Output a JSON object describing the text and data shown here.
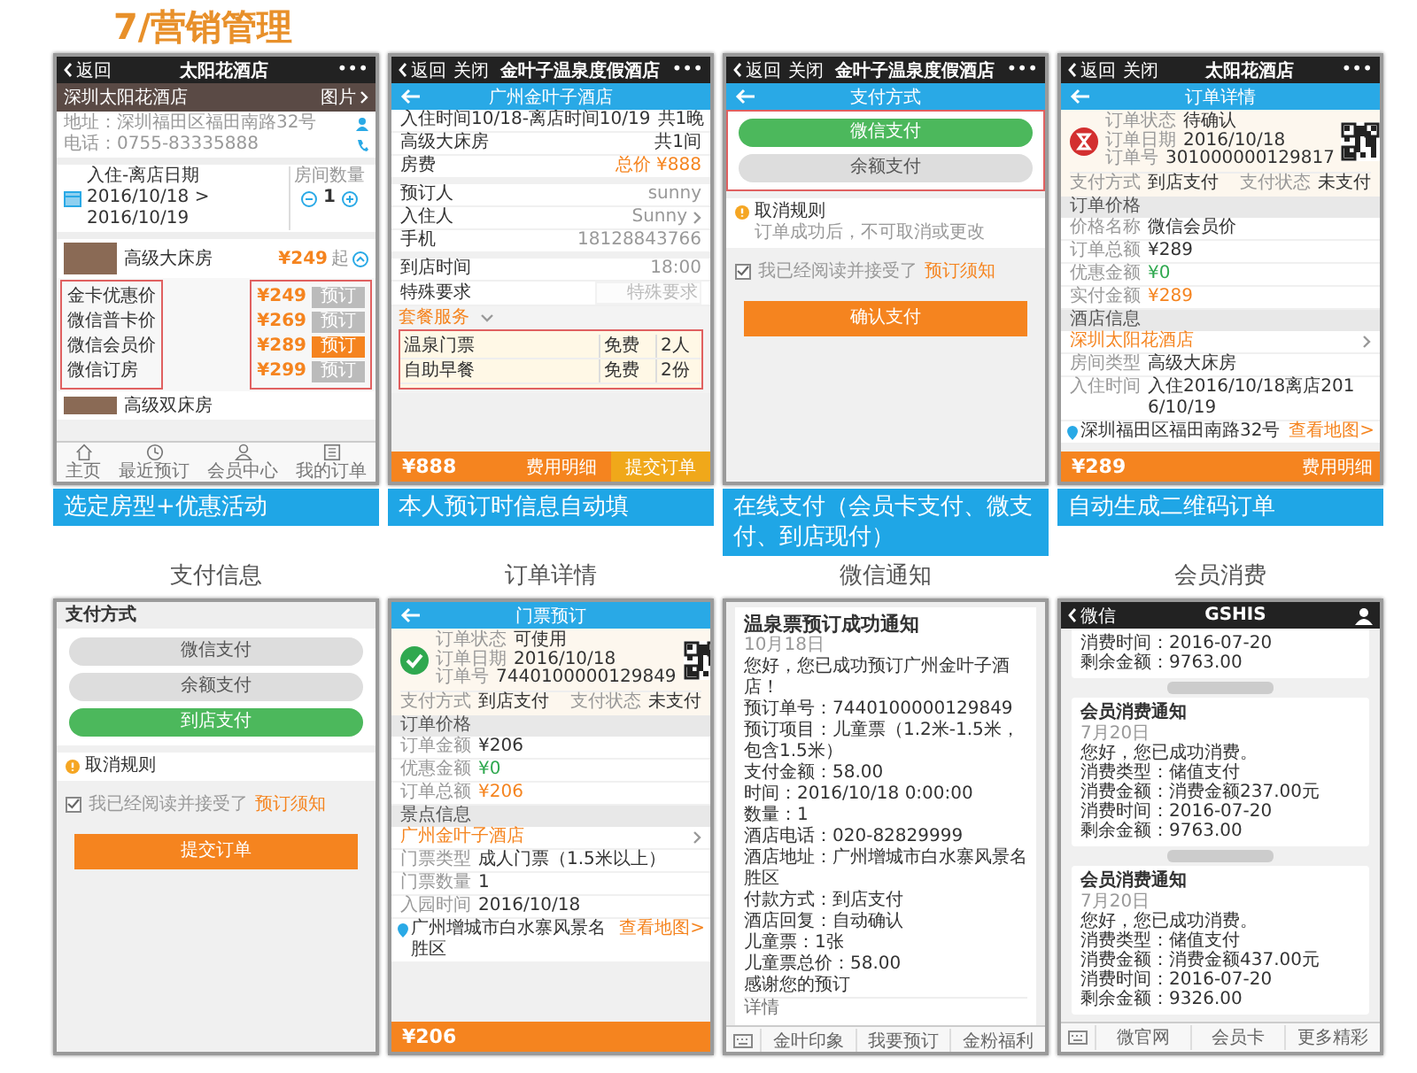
{
  "title": "7/营销管理",
  "top_row": [
    {
      "caption": "选定房型+优惠活动",
      "blocks": [
        {
          "kind": "navbar",
          "back": "返回",
          "title": "太阳花酒店",
          "more": "•••"
        },
        {
          "kind": "hotel",
          "name": "深圳太阳花酒店",
          "photos": "图片"
        },
        {
          "kind": "contact",
          "address": "地址：深圳福田区福田南路32号",
          "phone": "电话：0755-83335888"
        },
        {
          "kind": "dates",
          "label": "入住-离店日期",
          "range": "2016/10/18 > 2016/10/19",
          "count_label": "房间数量",
          "count": "1"
        },
        {
          "kind": "room",
          "name": "高级大床房",
          "price": "¥249",
          "unit": "起"
        },
        {
          "kind": "prices",
          "highlighted": true,
          "items": [
            {
              "label": "金卡优惠价",
              "price": "¥249",
              "button": "预订",
              "selected": false
            },
            {
              "label": "微信普卡价",
              "price": "¥269",
              "button": "预订",
              "selected": false
            },
            {
              "label": "微信会员价",
              "price": "¥289",
              "button": "预订",
              "selected": true
            },
            {
              "label": "微信订房",
              "price": "¥299",
              "button": "预订",
              "selected": false
            }
          ]
        },
        {
          "kind": "room_more",
          "name": "高级双床房"
        },
        {
          "kind": "tabbar",
          "items": [
            "主页",
            "最近预订",
            "会员中心",
            "我的订单"
          ]
        }
      ]
    },
    {
      "caption": "本人预订时信息自动填",
      "blocks": [
        {
          "kind": "navbar",
          "back": "返回",
          "close": "关闭",
          "title": "金叶子温泉度假酒店",
          "more": "•••"
        },
        {
          "kind": "bluebar",
          "title": "广州金叶子酒店"
        },
        {
          "kind": "row",
          "label": "入住时间10/18-离店时间10/19",
          "value": "共1晚"
        },
        {
          "kind": "row",
          "label": "高级大床房",
          "value": "共1间"
        },
        {
          "kind": "row",
          "label": "房费",
          "value": "总价 ¥888",
          "color": "#f5841f"
        },
        {
          "kind": "gap"
        },
        {
          "kind": "row",
          "label": "预订人",
          "value": "sunny",
          "color": "#999999"
        },
        {
          "kind": "row",
          "label": "入住人",
          "value": "Sunny",
          "color": "#999999",
          "link": true
        },
        {
          "kind": "row",
          "label": "手机",
          "value": "18128843766",
          "color": "#999999"
        },
        {
          "kind": "gap"
        },
        {
          "kind": "row",
          "label": "到店时间",
          "value": "18:00",
          "color": "#999999"
        },
        {
          "kind": "input_row",
          "label": "特殊要求",
          "placeholder": "特殊要求"
        },
        {
          "kind": "package",
          "label": "套餐服务",
          "highlighted": true,
          "rows": [
            {
              "item": "温泉门票",
              "price": "免费",
              "qty": "2人"
            },
            {
              "item": "自助早餐",
              "price": "免费",
              "qty": "2份"
            }
          ]
        },
        {
          "kind": "bottombar",
          "total": "¥888",
          "detail": "费用明细",
          "submit": "提交订单"
        }
      ]
    },
    {
      "caption": "在线支付（会员卡支付、微支付、到店现付）",
      "blocks": [
        {
          "kind": "navbar",
          "back": "返回",
          "close": "关闭",
          "title": "金叶子温泉度假酒店",
          "more": "•••"
        },
        {
          "kind": "bluebar",
          "title": "支付方式"
        },
        {
          "kind": "pills",
          "highlighted": true,
          "items": [
            {
              "label": "微信支付",
              "selected": true
            },
            {
              "label": "余额支付",
              "selected": false
            }
          ]
        },
        {
          "kind": "notice",
          "title": "取消规则",
          "text": "订单成功后，不可取消或更改"
        },
        {
          "kind": "agree",
          "checked": true,
          "text": "我已经阅读并接受了",
          "link": "预订须知"
        },
        {
          "kind": "button",
          "label": "确认支付"
        }
      ]
    },
    {
      "caption": "自动生成二维码订单",
      "blocks": [
        {
          "kind": "navbar",
          "back": "返回",
          "close": "关闭",
          "title": "太阳花酒店",
          "more": "•••"
        },
        {
          "kind": "bluebar",
          "title": "订单详情"
        },
        {
          "kind": "status",
          "confirmed": false,
          "lines": [
            {
              "label": "订单状态",
              "value": "待确认"
            },
            {
              "label": "订单日期",
              "value": "2016/10/18"
            },
            {
              "label": "订单号",
              "value": "301000000129817"
            }
          ],
          "pay": [
            {
              "label": "支付方式",
              "value": "到店支付"
            },
            {
              "label": "支付状态",
              "value": "未支付"
            }
          ]
        },
        {
          "kind": "section",
          "label": "订单价格"
        },
        {
          "kind": "info_row",
          "label": "价格名称",
          "value": "微信会员价"
        },
        {
          "kind": "info_row",
          "label": "订单总额",
          "value": "¥289"
        },
        {
          "kind": "info_row",
          "label": "优惠金额",
          "value": "¥0",
          "color": "#2fa84f"
        },
        {
          "kind": "info_row",
          "label": "实付金额",
          "value": "¥289",
          "color": "#f5841f"
        },
        {
          "kind": "section",
          "label": "酒店信息"
        },
        {
          "kind": "link_row",
          "label": "深圳太阳花酒店"
        },
        {
          "kind": "info_row",
          "label": "房间类型",
          "value": "高级大床房"
        },
        {
          "kind": "info_row",
          "label": "入住时间",
          "value": "入住2016/10/18离店2016/10/19"
        },
        {
          "kind": "map_row",
          "address": "深圳福田区福田南路32号",
          "link": "查看地图>"
        },
        {
          "kind": "bottombar",
          "total": "¥289",
          "detail": "费用明细"
        }
      ]
    }
  ],
  "bottom_row": [
    {
      "caption": "支付信息",
      "blocks": [
        {
          "kind": "group_title",
          "label": "支付方式"
        },
        {
          "kind": "pills",
          "highlighted": false,
          "items": [
            {
              "label": "微信支付",
              "selected": false
            },
            {
              "label": "余额支付",
              "selected": false
            },
            {
              "label": "到店支付",
              "selected": true
            }
          ]
        },
        {
          "kind": "notice",
          "title": "取消规则"
        },
        {
          "kind": "agree",
          "checked": true,
          "text": "我已经阅读并接受了",
          "link": "预订须知"
        },
        {
          "kind": "button",
          "label": "提交订单"
        }
      ]
    },
    {
      "caption": "订单详情",
      "blocks": [
        {
          "kind": "bluebar",
          "title": "门票预订"
        },
        {
          "kind": "status",
          "confirmed": true,
          "lines": [
            {
              "label": "订单状态",
              "value": "可使用"
            },
            {
              "label": "订单日期",
              "value": "2016/10/18"
            },
            {
              "label": "订单号",
              "value": "7440100000129849"
            }
          ],
          "pay": [
            {
              "label": "支付方式",
              "value": "到店支付"
            },
            {
              "label": "支付状态",
              "value": "未支付"
            }
          ]
        },
        {
          "kind": "section",
          "label": "订单价格"
        },
        {
          "kind": "info_row",
          "label": "订单金额",
          "value": "¥206"
        },
        {
          "kind": "info_row",
          "label": "优惠金额",
          "value": "¥0",
          "color": "#2fa84f"
        },
        {
          "kind": "info_row",
          "label": "订单总额",
          "value": "¥206",
          "color": "#f5841f"
        },
        {
          "kind": "section",
          "label": "景点信息"
        },
        {
          "kind": "link_row",
          "label": "广州金叶子酒店"
        },
        {
          "kind": "info_row",
          "label": "门票类型",
          "value": "成人门票（1.5米以上）"
        },
        {
          "kind": "info_row",
          "label": "门票数量",
          "value": "1"
        },
        {
          "kind": "info_row",
          "label": "入园时间",
          "value": "2016/10/18"
        },
        {
          "kind": "map_row",
          "address": "广州增城市白水寨风景名胜区",
          "link": "查看地图>"
        },
        {
          "kind": "bottombar",
          "total": "¥206"
        }
      ]
    },
    {
      "caption": "微信通知",
      "blocks": [
        {
          "kind": "message",
          "title": "温泉票预订成功通知",
          "date": "10月18日",
          "lines": [
            "您好，您已成功预订广州金叶子酒店！",
            "预订单号：7440100000129849",
            "预订项目：儿童票（1.2米-1.5米，包含1.5米）",
            "支付金额：58.00",
            "时间：2016/10/18 0:00:00",
            "数量：1",
            "酒店电话：020-82829999",
            "酒店地址：广州增城市白水寨风景名胜区",
            "付款方式：到店支付",
            "酒店回复：自动确认",
            "儿童票：1张",
            "儿童票总价：58.00",
            "感谢您的预订"
          ],
          "more": "详情"
        },
        {
          "kind": "menu",
          "items": [
            "金叶印象",
            "我要预订",
            "金粉福利"
          ]
        }
      ]
    },
    {
      "caption": "会员消费",
      "blocks": [
        {
          "kind": "navbar",
          "back": "微信",
          "title": "GSHIS",
          "person": true
        },
        {
          "kind": "msg_tail",
          "lines": [
            "消费时间：2016-07-20",
            "剩余金额：9763.00"
          ]
        },
        {
          "kind": "timepill"
        },
        {
          "kind": "msg_card",
          "title": "会员消费通知",
          "date": "7月20日",
          "greeting": "您好，您已成功消费。",
          "lines": [
            "消费类型：储值支付",
            "消费金额：消费金额237.00元",
            "消费时间：2016-07-20",
            "剩余金额：9763.00"
          ]
        },
        {
          "kind": "timepill"
        },
        {
          "kind": "msg_card",
          "title": "会员消费通知",
          "date": "7月20日",
          "greeting": "您好，您已成功消费。",
          "lines": [
            "消费类型：储值支付",
            "消费金额：消费金额437.00元",
            "消费时间：2016-07-20",
            "剩余金额：9326.00"
          ]
        },
        {
          "kind": "menu",
          "items": [
            "微官网",
            "会员卡",
            "更多精彩"
          ]
        }
      ]
    }
  ]
}
